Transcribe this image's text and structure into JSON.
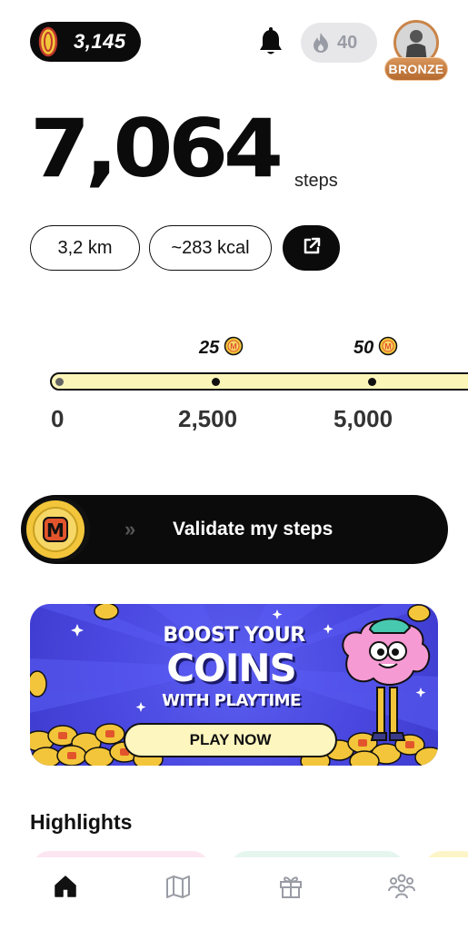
{
  "header": {
    "coin_balance": "3,145",
    "streak_count": "40",
    "rank_label": "BRONZE"
  },
  "steps": {
    "count": "7,064",
    "unit": "steps",
    "distance": "3,2 km",
    "calories": "~283 kcal"
  },
  "progress": {
    "rewards": [
      "25",
      "50"
    ],
    "milestones": [
      "0",
      "2,500",
      "5,000"
    ],
    "track_color": "#fbf5b8"
  },
  "validate": {
    "label": "Validate my steps",
    "chevrons": "»"
  },
  "banner": {
    "line1": "BOOST YOUR",
    "line2": "COINS",
    "line3": "WITH PLAYTIME",
    "button_label": "PLAY NOW",
    "background": "#4a48e0"
  },
  "highlights": {
    "title": "Highlights"
  },
  "nav": {
    "items": [
      "home-icon",
      "map-icon",
      "gift-icon",
      "friends-icon"
    ],
    "active": "home-icon"
  },
  "colors": {
    "coin_gold": "#f3c53a",
    "coin_red": "#e2552c",
    "bronze": "#c98447",
    "accent_dark": "#0b0b0b"
  }
}
